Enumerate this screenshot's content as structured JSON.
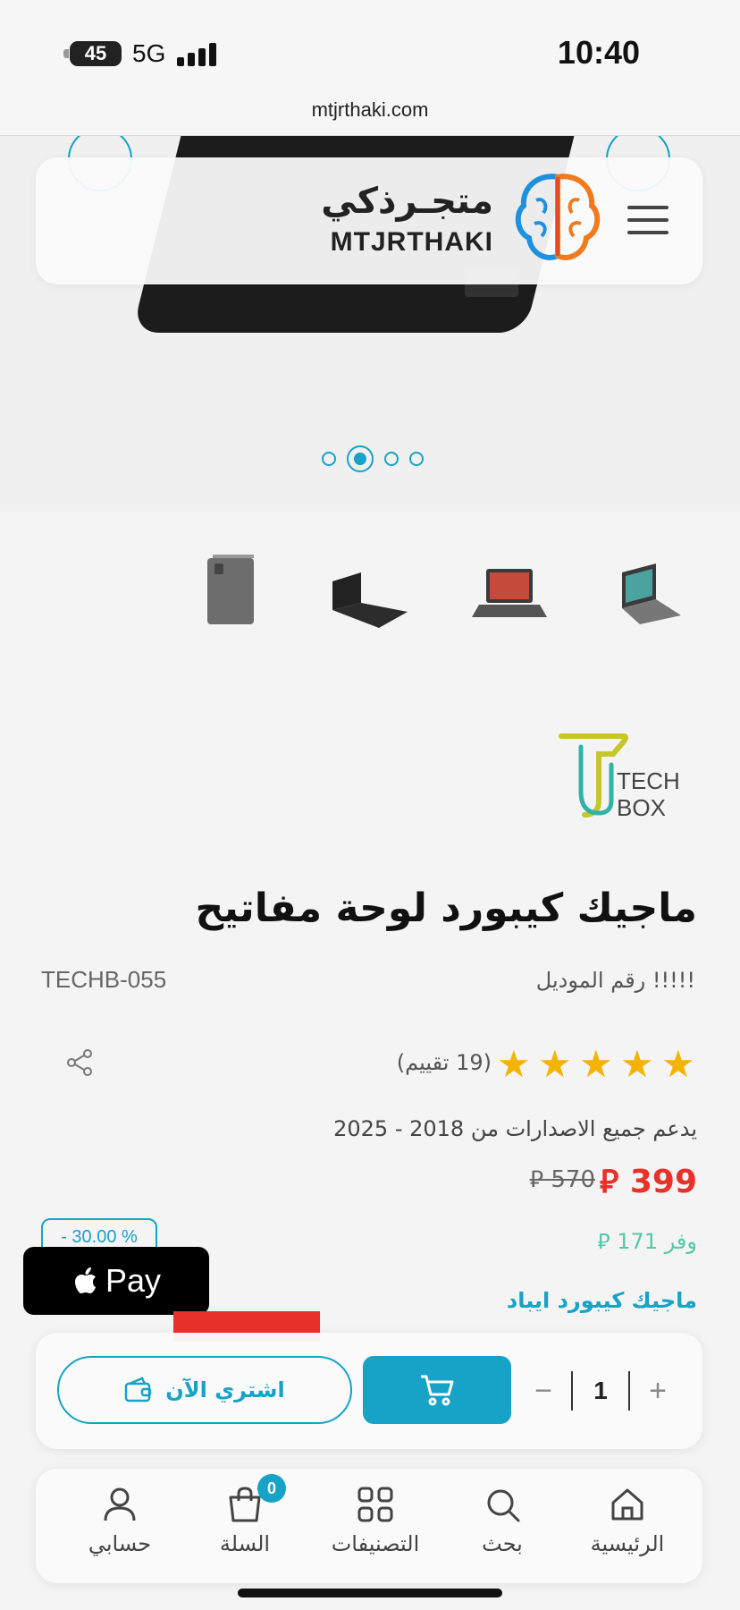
{
  "status_bar": {
    "battery": "45",
    "network": "5G",
    "time": "10:40"
  },
  "browser": {
    "url": "mtjrthaki.com"
  },
  "header": {
    "logo_arabic": "متجـرذكي",
    "logo_english": "MTJRTHAKI"
  },
  "gallery": {
    "slide_count": 4,
    "active_slide": 2,
    "thumbnails": [
      "folio-case",
      "keyboard-black",
      "keyboard-ipad-front",
      "keyboard-ipad-side"
    ]
  },
  "brand": {
    "name_line1": "TECH",
    "name_line2": "BOX"
  },
  "product": {
    "title": "ماجيك كيبورد لوحة مفاتيح",
    "model_label": "!!!!! رقم الموديل",
    "model_value": "TECHB-055",
    "rating_stars": 5,
    "rating_count": "(19 تقييم)",
    "support_text": "يدعم جميع الاصدارات من 2018 - 2025",
    "price": "399 ⃁",
    "old_price": "570 ⃁",
    "savings": "وفر 171 ⃁",
    "discount": "- 30.00 %",
    "description_title": "ماجيك كيبورد ايباد"
  },
  "apple_pay": {
    "label": "Pay"
  },
  "purchase": {
    "quantity": "1",
    "plus": "+",
    "minus": "−",
    "buy_now": "اشتري الآن"
  },
  "nav": {
    "home": "الرئيسية",
    "search": "بحث",
    "categories": "التصنيفات",
    "cart": "السلة",
    "cart_count": "0",
    "account": "حسابي"
  },
  "colors": {
    "accent": "#17a2c7",
    "price": "#e8312a",
    "savings": "#53c9a7",
    "star": "#f5b301"
  }
}
